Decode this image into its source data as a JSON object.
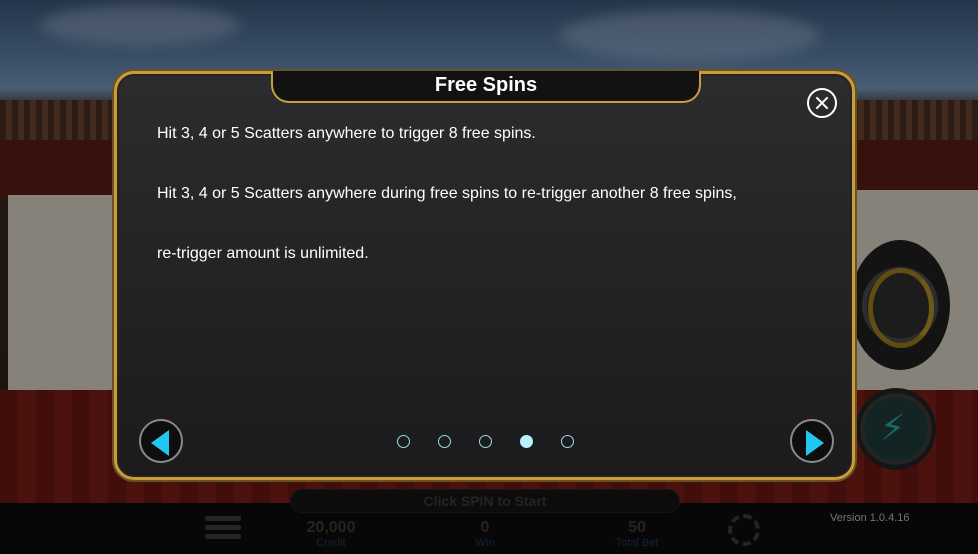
{
  "modal": {
    "title": "Free Spins",
    "paragraphs": [
      "Hit 3, 4 or 5 Scatters anywhere to trigger 8 free spins.",
      "Hit 3, 4 or 5 Scatters anywhere during free spins to re-trigger another 8 free spins,",
      "re-trigger amount is unlimited."
    ],
    "page_total": 5,
    "page_current": 4
  },
  "game": {
    "click_spin_label": "Click SPIN to Start",
    "credit_value": "20,000",
    "credit_label": "Credit",
    "win_value": "0",
    "win_label": "Win",
    "total_bet_value": "50",
    "total_bet_label": "Total Bet",
    "version": "Version 1.0.4.16"
  },
  "icons": {
    "close": "close-icon",
    "prev": "arrow-left-icon",
    "next": "arrow-right-icon",
    "menu": "menu-icon",
    "chip": "chip-icon",
    "spin": "spin-icon",
    "turbo": "lightning-icon"
  },
  "colors": {
    "accent": "#22c6f0",
    "frame_gold": "#c79e3f"
  }
}
